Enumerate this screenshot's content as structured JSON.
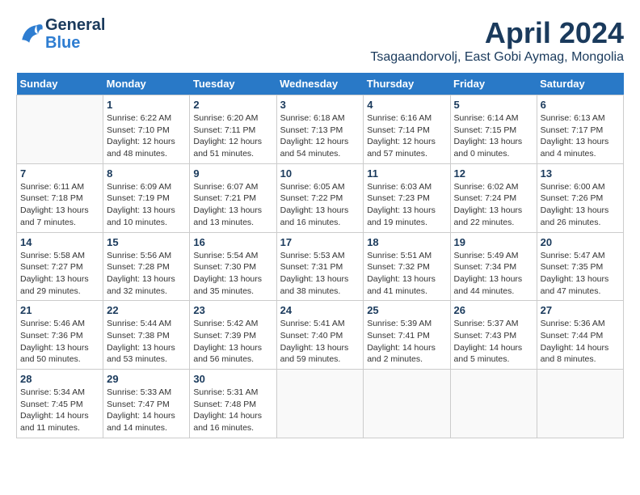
{
  "header": {
    "logo_line1": "General",
    "logo_line2": "Blue",
    "month": "April 2024",
    "location": "Tsagaandorvolj, East Gobi Aymag, Mongolia"
  },
  "weekdays": [
    "Sunday",
    "Monday",
    "Tuesday",
    "Wednesday",
    "Thursday",
    "Friday",
    "Saturday"
  ],
  "weeks": [
    [
      {
        "day": "",
        "sunrise": "",
        "sunset": "",
        "daylight": ""
      },
      {
        "day": "1",
        "sunrise": "Sunrise: 6:22 AM",
        "sunset": "Sunset: 7:10 PM",
        "daylight": "Daylight: 12 hours and 48 minutes."
      },
      {
        "day": "2",
        "sunrise": "Sunrise: 6:20 AM",
        "sunset": "Sunset: 7:11 PM",
        "daylight": "Daylight: 12 hours and 51 minutes."
      },
      {
        "day": "3",
        "sunrise": "Sunrise: 6:18 AM",
        "sunset": "Sunset: 7:13 PM",
        "daylight": "Daylight: 12 hours and 54 minutes."
      },
      {
        "day": "4",
        "sunrise": "Sunrise: 6:16 AM",
        "sunset": "Sunset: 7:14 PM",
        "daylight": "Daylight: 12 hours and 57 minutes."
      },
      {
        "day": "5",
        "sunrise": "Sunrise: 6:14 AM",
        "sunset": "Sunset: 7:15 PM",
        "daylight": "Daylight: 13 hours and 0 minutes."
      },
      {
        "day": "6",
        "sunrise": "Sunrise: 6:13 AM",
        "sunset": "Sunset: 7:17 PM",
        "daylight": "Daylight: 13 hours and 4 minutes."
      }
    ],
    [
      {
        "day": "7",
        "sunrise": "Sunrise: 6:11 AM",
        "sunset": "Sunset: 7:18 PM",
        "daylight": "Daylight: 13 hours and 7 minutes."
      },
      {
        "day": "8",
        "sunrise": "Sunrise: 6:09 AM",
        "sunset": "Sunset: 7:19 PM",
        "daylight": "Daylight: 13 hours and 10 minutes."
      },
      {
        "day": "9",
        "sunrise": "Sunrise: 6:07 AM",
        "sunset": "Sunset: 7:21 PM",
        "daylight": "Daylight: 13 hours and 13 minutes."
      },
      {
        "day": "10",
        "sunrise": "Sunrise: 6:05 AM",
        "sunset": "Sunset: 7:22 PM",
        "daylight": "Daylight: 13 hours and 16 minutes."
      },
      {
        "day": "11",
        "sunrise": "Sunrise: 6:03 AM",
        "sunset": "Sunset: 7:23 PM",
        "daylight": "Daylight: 13 hours and 19 minutes."
      },
      {
        "day": "12",
        "sunrise": "Sunrise: 6:02 AM",
        "sunset": "Sunset: 7:24 PM",
        "daylight": "Daylight: 13 hours and 22 minutes."
      },
      {
        "day": "13",
        "sunrise": "Sunrise: 6:00 AM",
        "sunset": "Sunset: 7:26 PM",
        "daylight": "Daylight: 13 hours and 26 minutes."
      }
    ],
    [
      {
        "day": "14",
        "sunrise": "Sunrise: 5:58 AM",
        "sunset": "Sunset: 7:27 PM",
        "daylight": "Daylight: 13 hours and 29 minutes."
      },
      {
        "day": "15",
        "sunrise": "Sunrise: 5:56 AM",
        "sunset": "Sunset: 7:28 PM",
        "daylight": "Daylight: 13 hours and 32 minutes."
      },
      {
        "day": "16",
        "sunrise": "Sunrise: 5:54 AM",
        "sunset": "Sunset: 7:30 PM",
        "daylight": "Daylight: 13 hours and 35 minutes."
      },
      {
        "day": "17",
        "sunrise": "Sunrise: 5:53 AM",
        "sunset": "Sunset: 7:31 PM",
        "daylight": "Daylight: 13 hours and 38 minutes."
      },
      {
        "day": "18",
        "sunrise": "Sunrise: 5:51 AM",
        "sunset": "Sunset: 7:32 PM",
        "daylight": "Daylight: 13 hours and 41 minutes."
      },
      {
        "day": "19",
        "sunrise": "Sunrise: 5:49 AM",
        "sunset": "Sunset: 7:34 PM",
        "daylight": "Daylight: 13 hours and 44 minutes."
      },
      {
        "day": "20",
        "sunrise": "Sunrise: 5:47 AM",
        "sunset": "Sunset: 7:35 PM",
        "daylight": "Daylight: 13 hours and 47 minutes."
      }
    ],
    [
      {
        "day": "21",
        "sunrise": "Sunrise: 5:46 AM",
        "sunset": "Sunset: 7:36 PM",
        "daylight": "Daylight: 13 hours and 50 minutes."
      },
      {
        "day": "22",
        "sunrise": "Sunrise: 5:44 AM",
        "sunset": "Sunset: 7:38 PM",
        "daylight": "Daylight: 13 hours and 53 minutes."
      },
      {
        "day": "23",
        "sunrise": "Sunrise: 5:42 AM",
        "sunset": "Sunset: 7:39 PM",
        "daylight": "Daylight: 13 hours and 56 minutes."
      },
      {
        "day": "24",
        "sunrise": "Sunrise: 5:41 AM",
        "sunset": "Sunset: 7:40 PM",
        "daylight": "Daylight: 13 hours and 59 minutes."
      },
      {
        "day": "25",
        "sunrise": "Sunrise: 5:39 AM",
        "sunset": "Sunset: 7:41 PM",
        "daylight": "Daylight: 14 hours and 2 minutes."
      },
      {
        "day": "26",
        "sunrise": "Sunrise: 5:37 AM",
        "sunset": "Sunset: 7:43 PM",
        "daylight": "Daylight: 14 hours and 5 minutes."
      },
      {
        "day": "27",
        "sunrise": "Sunrise: 5:36 AM",
        "sunset": "Sunset: 7:44 PM",
        "daylight": "Daylight: 14 hours and 8 minutes."
      }
    ],
    [
      {
        "day": "28",
        "sunrise": "Sunrise: 5:34 AM",
        "sunset": "Sunset: 7:45 PM",
        "daylight": "Daylight: 14 hours and 11 minutes."
      },
      {
        "day": "29",
        "sunrise": "Sunrise: 5:33 AM",
        "sunset": "Sunset: 7:47 PM",
        "daylight": "Daylight: 14 hours and 14 minutes."
      },
      {
        "day": "30",
        "sunrise": "Sunrise: 5:31 AM",
        "sunset": "Sunset: 7:48 PM",
        "daylight": "Daylight: 14 hours and 16 minutes."
      },
      {
        "day": "",
        "sunrise": "",
        "sunset": "",
        "daylight": ""
      },
      {
        "day": "",
        "sunrise": "",
        "sunset": "",
        "daylight": ""
      },
      {
        "day": "",
        "sunrise": "",
        "sunset": "",
        "daylight": ""
      },
      {
        "day": "",
        "sunrise": "",
        "sunset": "",
        "daylight": ""
      }
    ]
  ]
}
